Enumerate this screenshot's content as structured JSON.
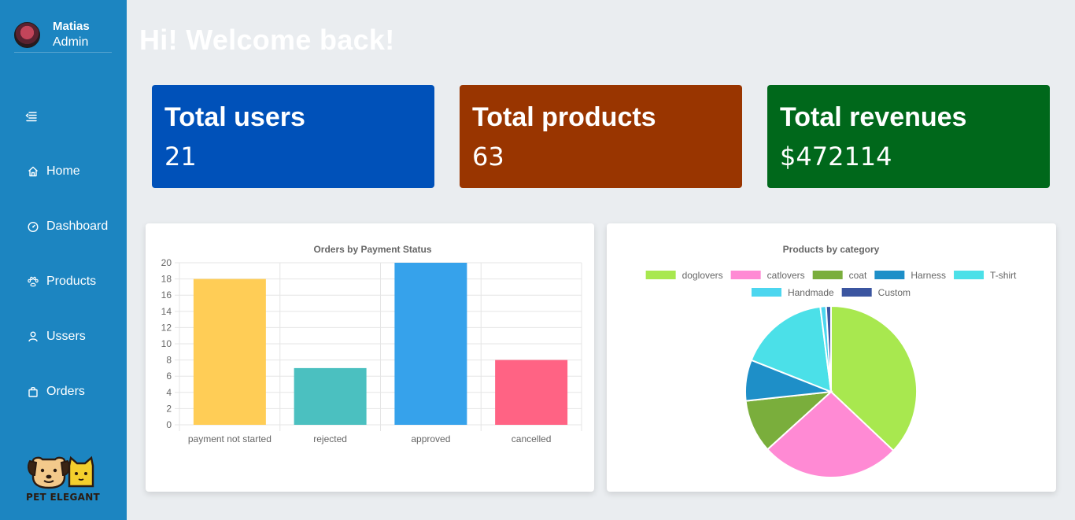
{
  "user": {
    "name": "Matias",
    "role": "Admin"
  },
  "nav": [
    {
      "label": "Home",
      "icon": "home-icon"
    },
    {
      "label": "Dashboard",
      "icon": "dashboard-icon"
    },
    {
      "label": "Products",
      "icon": "paw-icon"
    },
    {
      "label": "Ussers",
      "icon": "user-icon"
    },
    {
      "label": "Orders",
      "icon": "bag-icon"
    }
  ],
  "brand": {
    "name": "PET ELEGANT"
  },
  "greeting": "Hi! Welcome back!",
  "cards": [
    {
      "title": "Total users",
      "value": "21",
      "color": "#0051b9"
    },
    {
      "title": "Total products",
      "value": "63",
      "color": "#993500"
    },
    {
      "title": "Total revenues",
      "value": "$472114",
      "color": "#00681b"
    }
  ],
  "chart_data": [
    {
      "type": "bar",
      "title": "Orders by Payment Status",
      "categories": [
        "payment not started",
        "rejected",
        "approved",
        "cancelled"
      ],
      "values": [
        18,
        7,
        20,
        8
      ],
      "colors": [
        "#ffcd56",
        "#4bc0c0",
        "#36a2eb",
        "#ff6384"
      ],
      "ylim": [
        0,
        20
      ],
      "yticks": [
        0,
        2,
        4,
        6,
        8,
        10,
        12,
        14,
        16,
        18,
        20
      ],
      "grid": true
    },
    {
      "type": "pie",
      "title": "Products by  category",
      "legend_position": "top",
      "categories": [
        "doglovers",
        "catlovers",
        "coat",
        "Harness",
        "T-shirt",
        "Handmade",
        "Custom"
      ],
      "values": [
        24,
        17,
        6.5,
        5,
        11,
        0.7,
        0.6
      ],
      "colors": [
        "#a8e84f",
        "#ff8ad4",
        "#7aae3c",
        "#1e8fc8",
        "#4be0e8",
        "#4cd6ef",
        "#3b55a0"
      ]
    }
  ]
}
